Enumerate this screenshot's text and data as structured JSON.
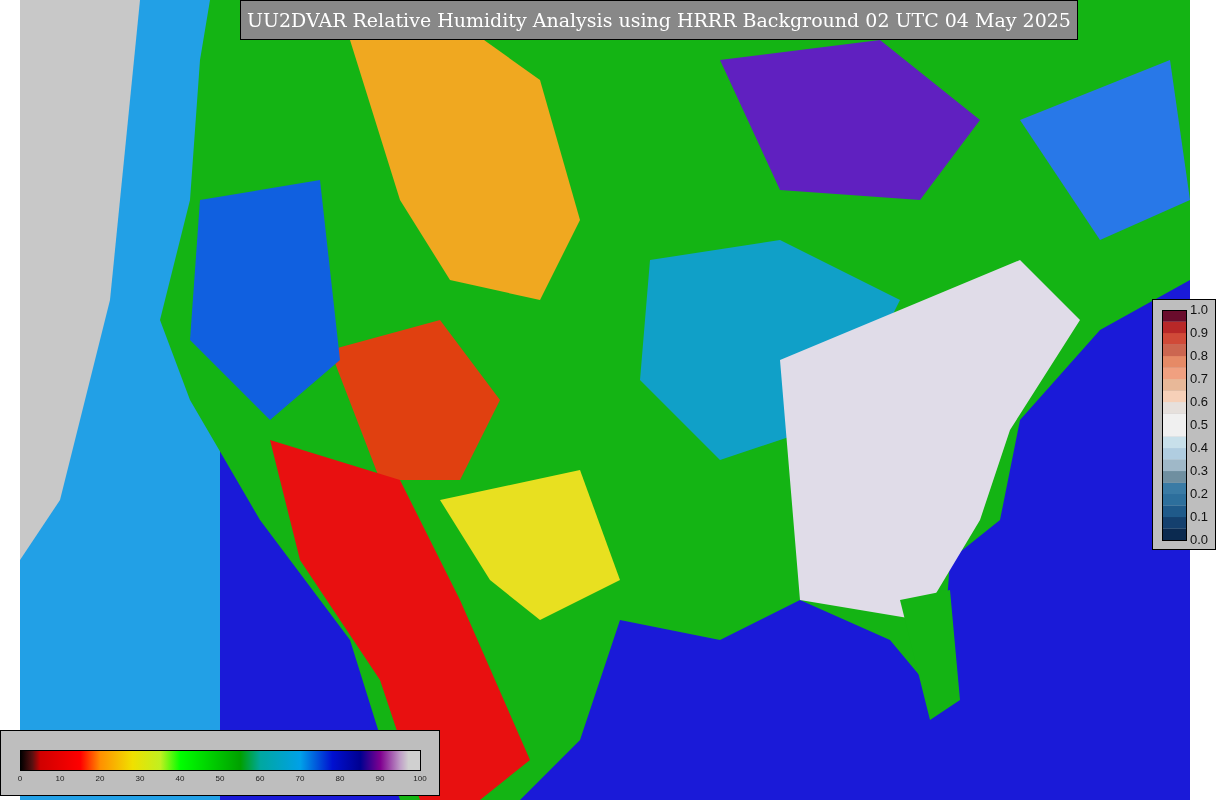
{
  "title": "UU2DVAR Relative Humidity Analysis using HRRR Background 02 UTC 04 May 2025",
  "humidity_colorbar": {
    "ticks": [
      "0",
      "10",
      "20",
      "30",
      "40",
      "50",
      "60",
      "70",
      "80",
      "90",
      "100"
    ]
  },
  "observation_colorbar": {
    "ticks": [
      "1.0",
      "0.9",
      "0.8",
      "0.7",
      "0.6",
      "0.5",
      "0.4",
      "0.3",
      "0.2",
      "0.1",
      "0.0"
    ]
  }
}
